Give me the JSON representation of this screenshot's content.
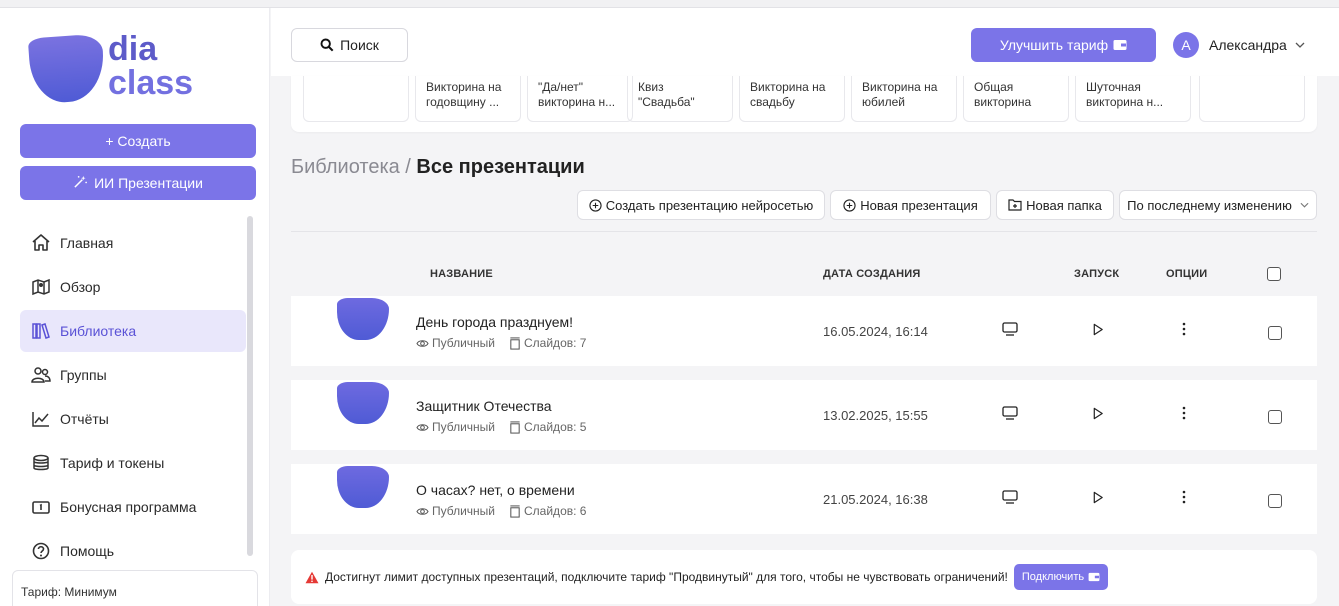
{
  "brand": {
    "line1": "dia",
    "line2": "class"
  },
  "sidebar": {
    "create_label": "+ Создать",
    "ai_label": "ИИ Презентации",
    "items": [
      {
        "label": "Главная",
        "icon": "home-icon"
      },
      {
        "label": "Обзор",
        "icon": "map-icon"
      },
      {
        "label": "Библиотека",
        "icon": "books-icon"
      },
      {
        "label": "Группы",
        "icon": "users-icon"
      },
      {
        "label": "Отчёты",
        "icon": "chart-icon"
      },
      {
        "label": "Тариф и токены",
        "icon": "coins-icon"
      },
      {
        "label": "Бонусная программа",
        "icon": "ticket-icon"
      },
      {
        "label": "Помощь",
        "icon": "help-icon"
      }
    ],
    "active_item": "Библиотека",
    "tariff_label": "Тариф: Минимум"
  },
  "header": {
    "search_label": "Поиск",
    "upgrade_label": "Улучшить тариф",
    "user_initial": "A",
    "user_name": "Александра"
  },
  "templates": [
    {
      "line1": "",
      "line2": ""
    },
    {
      "line1": "Викторина на",
      "line2": "годовщину ..."
    },
    {
      "line1": "\"Да/нет\"",
      "line2": "викторина н..."
    },
    {
      "line1": "Квиз",
      "line2": "\"Свадьба\""
    },
    {
      "line1": "Викторина на",
      "line2": "свадьбу"
    },
    {
      "line1": "Викторина на",
      "line2": "юбилей"
    },
    {
      "line1": "Общая",
      "line2": "викторина"
    },
    {
      "line1": "Шуточная",
      "line2": "викторина н..."
    },
    {
      "line1": "",
      "line2": ""
    }
  ],
  "page": {
    "breadcrumb": "Библиотека / ",
    "title": "Все презентации"
  },
  "actions": {
    "ai_create": "Создать презентацию нейросетью",
    "new_presentation": "Новая презентация",
    "new_folder": "Новая папка",
    "sort": "По последнему изменению"
  },
  "table": {
    "headers": {
      "name": "НАЗВАНИЕ",
      "date": "ДАТА СОЗДАНИЯ",
      "launch": "ЗАПУСК",
      "options": "ОПЦИИ"
    },
    "rows": [
      {
        "title": "День города празднуем!",
        "visibility": "Публичный",
        "slides": "Слайдов: 7",
        "date": "16.05.2024, 16:14"
      },
      {
        "title": "Защитник Отечества",
        "visibility": "Публичный",
        "slides": "Слайдов: 5",
        "date": "13.02.2025, 15:55"
      },
      {
        "title": "О часах? нет, о времени",
        "visibility": "Публичный",
        "slides": "Слайдов: 6",
        "date": "21.05.2024, 16:38"
      }
    ]
  },
  "alert": {
    "text": "Достигнут лимит доступных презентаций, подключите тариф \"Продвинутый\" для того, чтобы не чувствовать ограничений!",
    "button": "Подключить"
  },
  "colors": {
    "accent": "#7b74e8",
    "active_bg": "#e9e7fb",
    "warning": "#e53935"
  }
}
